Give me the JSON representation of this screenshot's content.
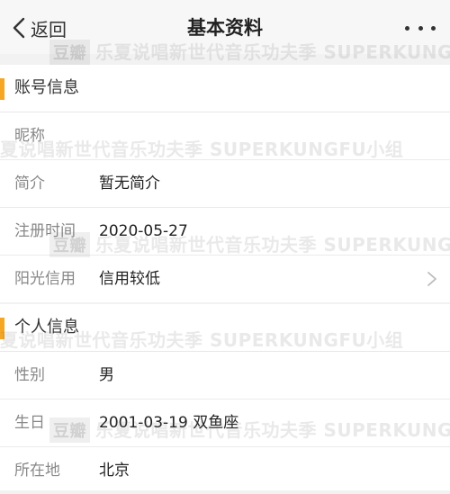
{
  "header": {
    "back_label": "返回",
    "title": "基本资料"
  },
  "account": {
    "title": "账号信息",
    "rows": [
      {
        "label": "昵称",
        "value": ""
      },
      {
        "label": "简介",
        "value": "暂无简介"
      },
      {
        "label": "注册时间",
        "value": "2020-05-27"
      },
      {
        "label": "阳光信用",
        "value": "信用较低"
      }
    ]
  },
  "personal": {
    "title": "个人信息",
    "rows": [
      {
        "label": "性别",
        "value": "男"
      },
      {
        "label": "生日",
        "value": "2001-03-19  双鱼座"
      },
      {
        "label": "所在地",
        "value": "北京"
      }
    ]
  },
  "watermark": {
    "logo": "豆瓣",
    "text_a": "乐夏说唱新世代音乐功夫季 SUPERKUNGFU",
    "text_b": "夏说唱新世代音乐功夫季 SUPERKUNGFU小组"
  },
  "icons": {
    "back": "chevron-left-icon",
    "more": "more-dots-icon",
    "row_arrow": "chevron-right-icon"
  },
  "colors": {
    "accent": "#f5a623",
    "background": "#f2f2f2"
  }
}
